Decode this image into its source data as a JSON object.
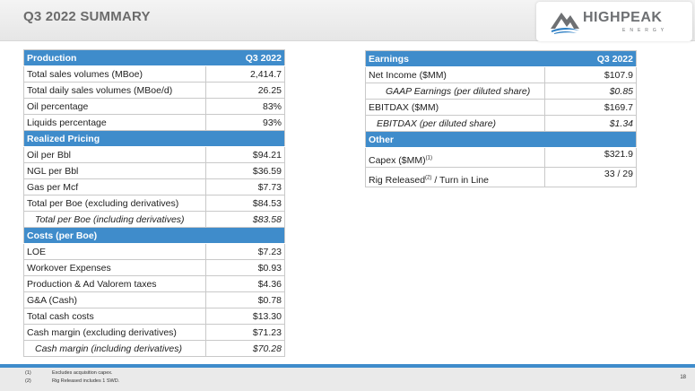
{
  "header": {
    "title": "Q3 2022 SUMMARY",
    "logo_word": "HIGHPEAK",
    "logo_sub": "ENERGY"
  },
  "left_table": {
    "sections": [
      {
        "header": "Production",
        "col": "Q3 2022",
        "rows": [
          {
            "label": "Total sales volumes (MBoe)",
            "value": "2,414.7"
          },
          {
            "label": "Total daily sales volumes (MBoe/d)",
            "value": "26.25"
          },
          {
            "label": "Oil percentage",
            "value": "83%"
          },
          {
            "label": "Liquids percentage",
            "value": "93%"
          }
        ]
      },
      {
        "header": "Realized Pricing",
        "col": "",
        "rows": [
          {
            "label": "Oil per Bbl",
            "value": "$94.21"
          },
          {
            "label": "NGL per Bbl",
            "value": "$36.59"
          },
          {
            "label": "Gas per Mcf",
            "value": "$7.73"
          },
          {
            "label": "Total per Boe (excluding derivatives)",
            "value": "$84.53"
          },
          {
            "label": "Total per Boe (including derivatives)",
            "value": "$83.58",
            "italic": true
          }
        ]
      },
      {
        "header": "Costs (per Boe)",
        "col": "",
        "rows": [
          {
            "label": "LOE",
            "value": "$7.23"
          },
          {
            "label": "Workover Expenses",
            "value": "$0.93"
          },
          {
            "label": "Production & Ad Valorem taxes",
            "value": "$4.36"
          },
          {
            "label": "G&A (Cash)",
            "value": "$0.78"
          },
          {
            "label": "Total cash costs",
            "value": "$13.30"
          },
          {
            "label": "Cash margin (excluding derivatives)",
            "value": "$71.23"
          },
          {
            "label": "Cash margin (including derivatives)",
            "value": "$70.28",
            "italic": true
          }
        ]
      }
    ]
  },
  "right_table": {
    "earnings": {
      "header": "Earnings",
      "col": "Q3 2022",
      "rows": [
        {
          "label": "Net Income ($MM)",
          "value": "$107.9"
        },
        {
          "label": "GAAP Earnings (per diluted share)",
          "value": "$0.85",
          "italic": true
        },
        {
          "label": "EBITDAX ($MM)",
          "value": "$169.7"
        },
        {
          "label": "EBITDAX (per diluted share)",
          "value": "$1.34",
          "italic": true
        }
      ]
    },
    "other": {
      "header": "Other",
      "capex_label": "Capex ($MM)",
      "capex_sup": "(1)",
      "capex_value": "$321.9",
      "rig_label": "Rig Released",
      "rig_sup": "(2)",
      "rig_label_tail": "/ Turn in Line",
      "rig_value": "33 / 29"
    }
  },
  "footer": {
    "notes": [
      {
        "num": "(1)",
        "text": "Excludes acquisition capex."
      },
      {
        "num": "(2)",
        "text": "Rig Released includes 1 SWD."
      }
    ],
    "page_number": "18"
  },
  "colors": {
    "header_blue": "#3f8ccb",
    "logo_blue": "#2e7fc4",
    "logo_gray": "#6e7073"
  }
}
